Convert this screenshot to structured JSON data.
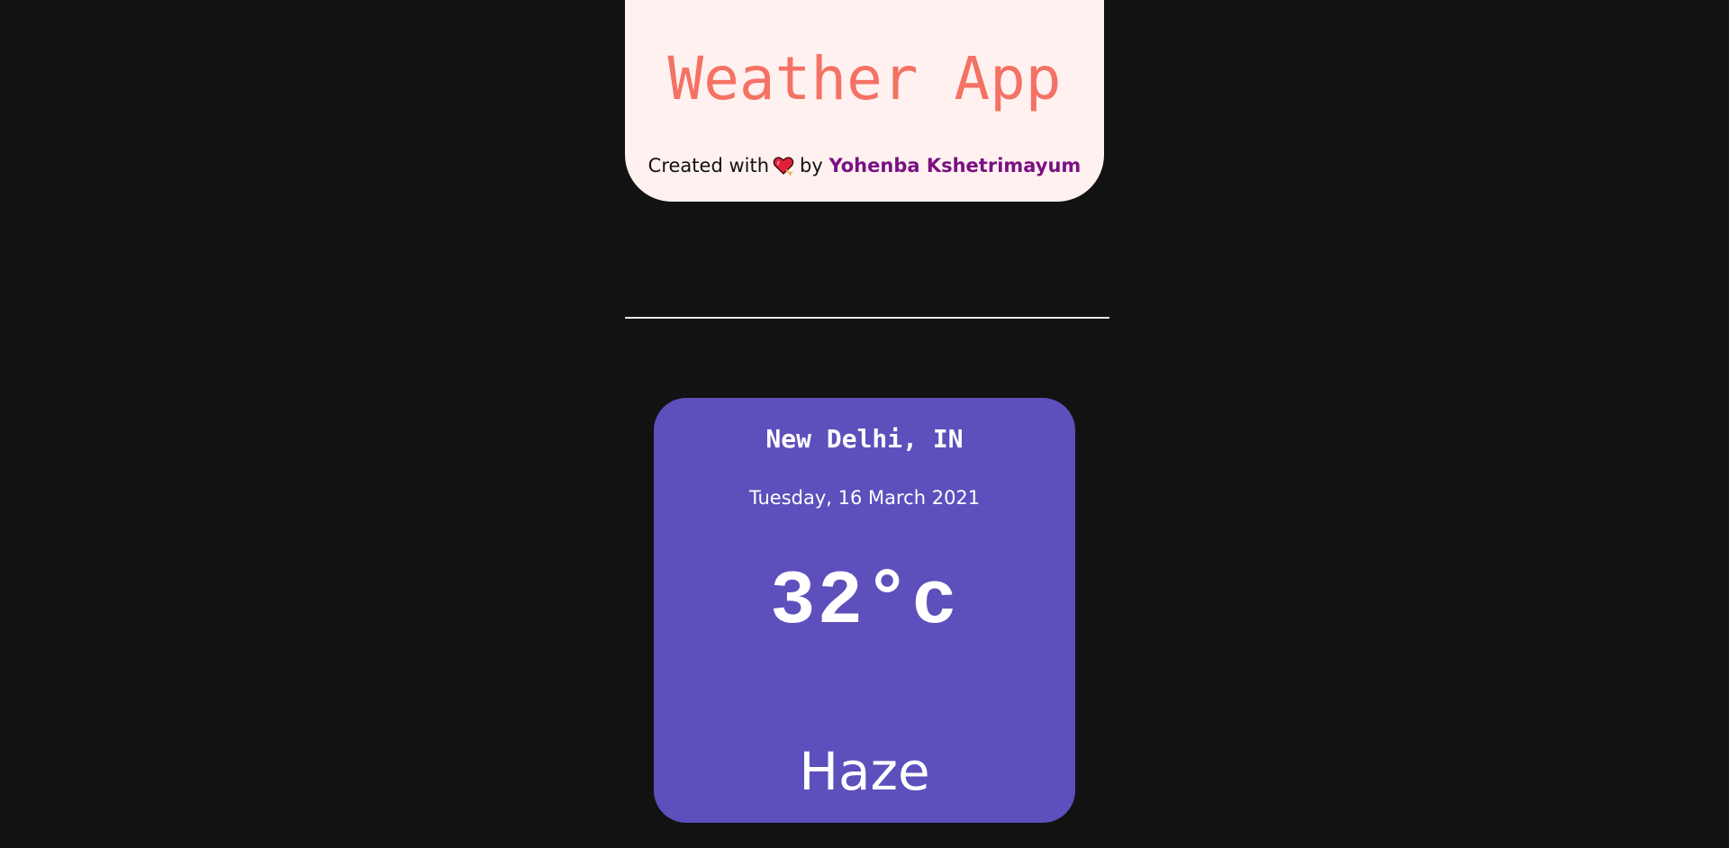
{
  "header": {
    "title": "Weather App",
    "credit_prefix": "Created with",
    "credit_by": "by",
    "author": "Yohenba Kshetrimayum",
    "heart_icon": "heart-icon",
    "title_color": "#f47265",
    "author_color": "#7b1083"
  },
  "weather": {
    "location": "New Delhi, IN",
    "date": "Tuesday, 16 March 2021",
    "temperature": "32°c",
    "condition": "Haze",
    "card_color": "#5d50bc"
  }
}
